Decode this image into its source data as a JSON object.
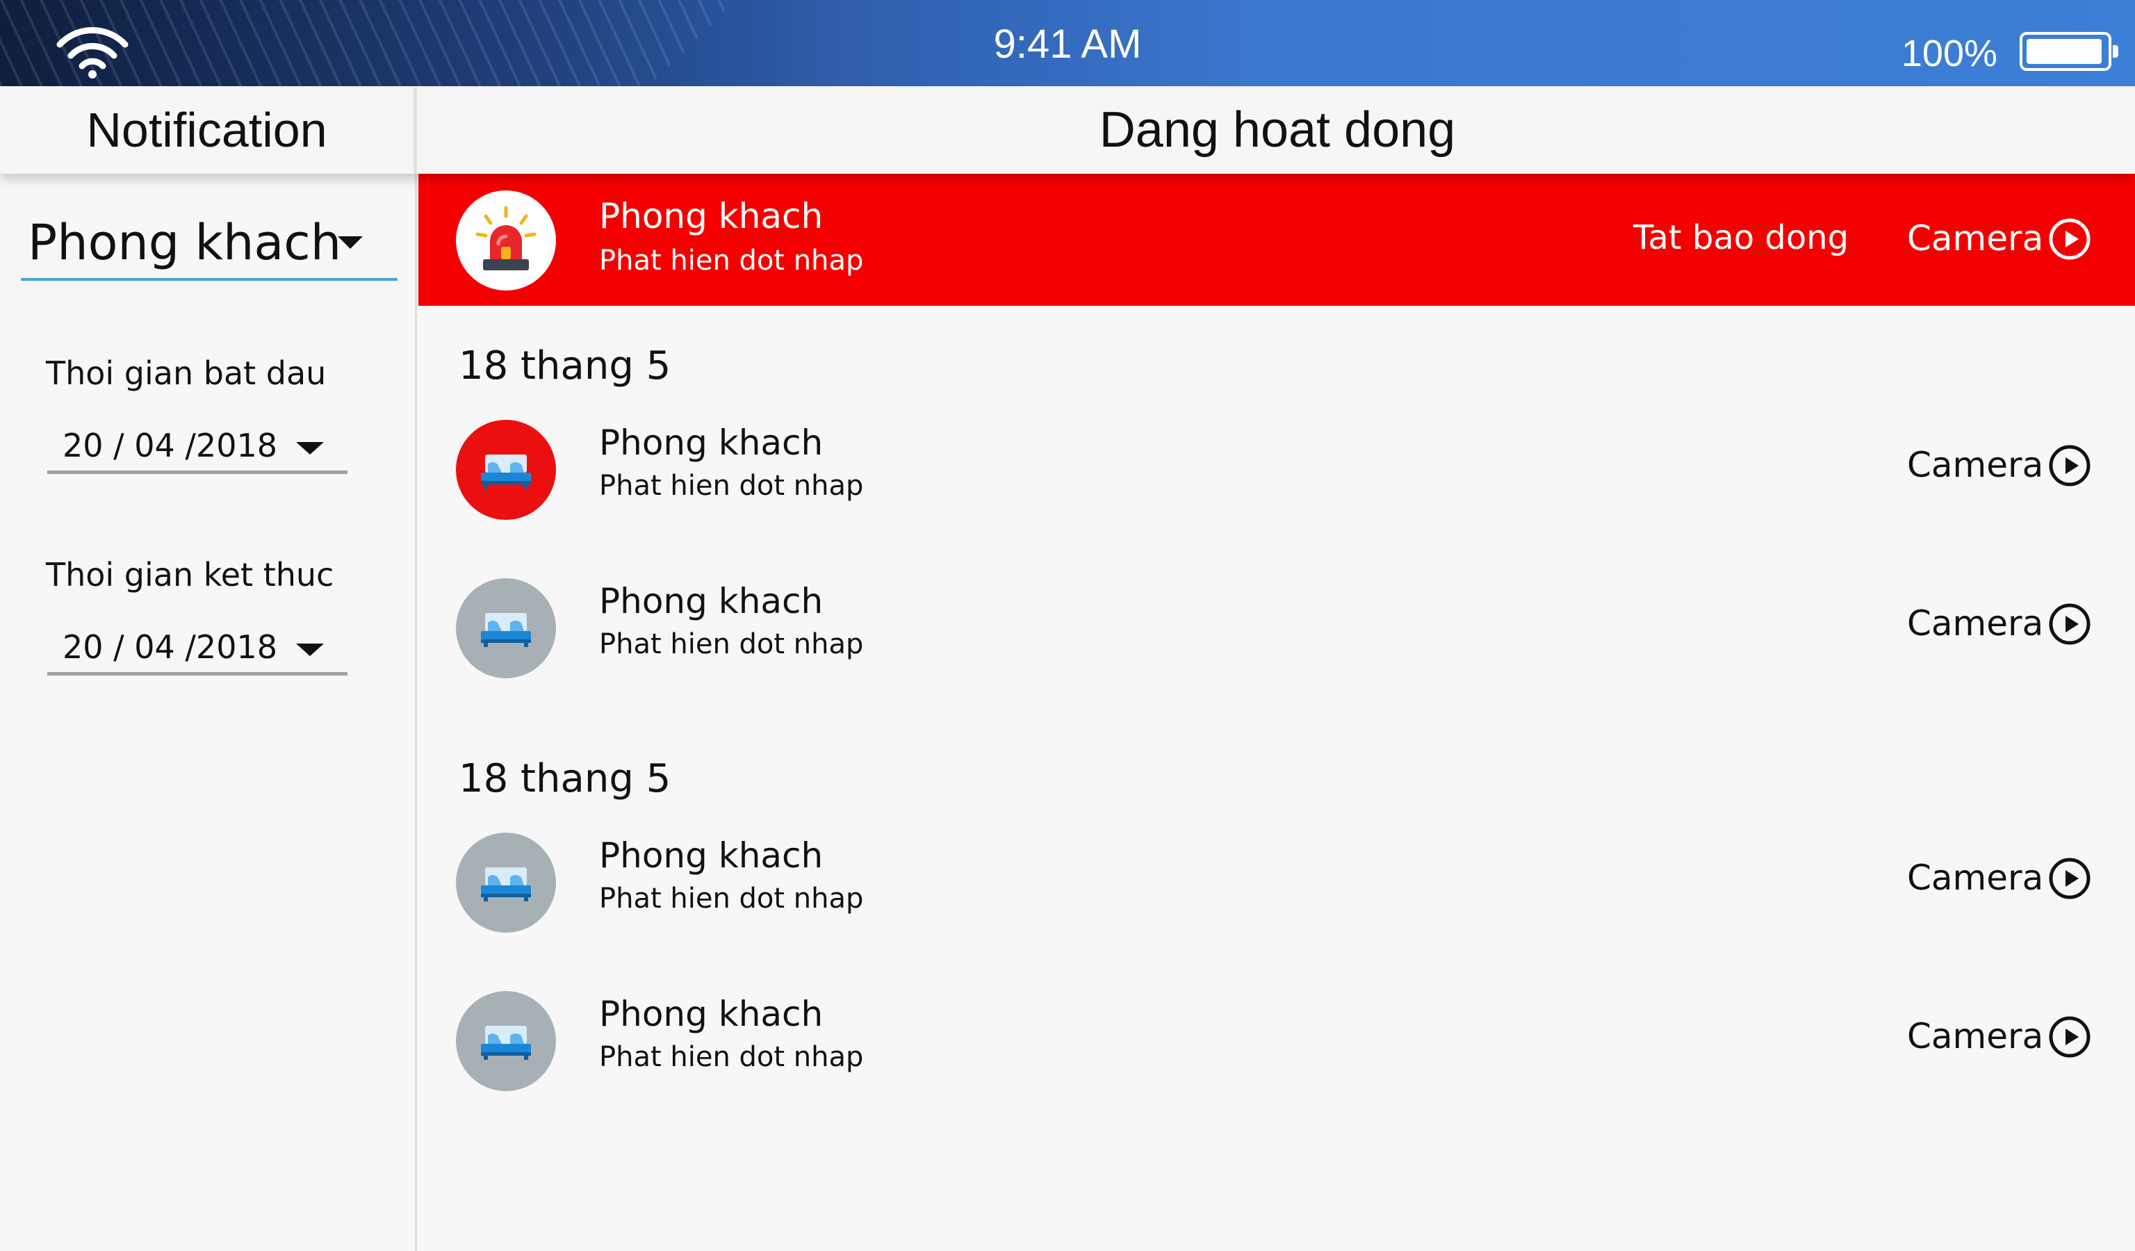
{
  "status_bar": {
    "time": "9:41 AM",
    "battery": "100%",
    "wifi_icon": "wifi-icon",
    "battery_icon": "battery-full-icon"
  },
  "header": {
    "left_title": "Notification",
    "main_title": "Dang hoat dong"
  },
  "sidebar": {
    "room": "Phong khach",
    "start_label": "Thoi gian bat dau",
    "start_date": "20 / 04 /2018",
    "end_label": "Thoi gian ket thuc",
    "end_date": "20 / 04 /2018"
  },
  "alert": {
    "title": "Phong khach",
    "subtitle": "Phat hien dot nhap",
    "dismiss_label": "Tat bao dong",
    "camera_label": "Camera",
    "icon": "siren-icon",
    "color": "#f40000"
  },
  "groups": [
    {
      "date": "18 thang 5",
      "items": [
        {
          "title": "Phong khach",
          "subtitle": "Phat hien dot nhap",
          "camera_label": "Camera",
          "icon": "bed-icon",
          "state": "active"
        },
        {
          "title": "Phong khach",
          "subtitle": "Phat hien dot nhap",
          "camera_label": "Camera",
          "icon": "bed-icon",
          "state": "inactive"
        }
      ]
    },
    {
      "date": "18 thang 5",
      "items": [
        {
          "title": "Phong khach",
          "subtitle": "Phat hien dot nhap",
          "camera_label": "Camera",
          "icon": "bed-icon",
          "state": "inactive"
        },
        {
          "title": "Phong khach",
          "subtitle": "Phat hien dot nhap",
          "camera_label": "Camera",
          "icon": "bed-icon",
          "state": "inactive"
        }
      ]
    }
  ],
  "colors": {
    "alert_red": "#f40000",
    "active_avatar": "#ec0f0f",
    "inactive_avatar": "#a7b1b5",
    "accent_underline": "#4aa3df"
  }
}
